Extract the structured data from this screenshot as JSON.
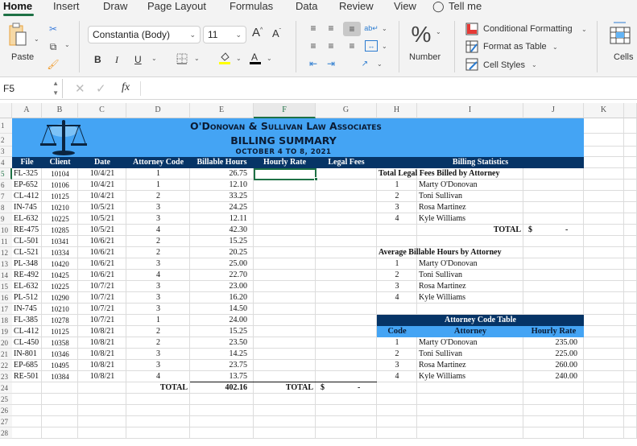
{
  "menu_tabs": [
    "Home",
    "Insert",
    "Draw",
    "Page Layout",
    "Formulas",
    "Data",
    "Review",
    "View",
    "Tell me"
  ],
  "ribbon": {
    "paste": "Paste",
    "font_name": "Constantia (Body)",
    "font_size": "11",
    "bold": "B",
    "italic": "I",
    "underline": "U",
    "number_label": "Number",
    "conditional_formatting": "Conditional Formatting",
    "format_as_table": "Format as Table",
    "cell_styles": "Cell Styles",
    "cells": "Cells",
    "highlight_color": "#ffff00",
    "font_color": "#000000"
  },
  "formula_bar": {
    "name_box": "F5",
    "fx": "fx",
    "value": ""
  },
  "columns": [
    "A",
    "B",
    "C",
    "D",
    "E",
    "F",
    "G",
    "H",
    "I",
    "J",
    "K"
  ],
  "selected_column": "F",
  "selected_row": "5",
  "rows": [
    "1",
    "2",
    "3",
    "4",
    "5",
    "6",
    "7",
    "8",
    "9",
    "10",
    "11",
    "12",
    "13",
    "14",
    "15",
    "16",
    "17",
    "18",
    "19",
    "20",
    "21",
    "22",
    "23",
    "24",
    "25",
    "26",
    "27",
    "28"
  ],
  "colors": {
    "band_light": "#44a4f4",
    "band_dark": "#063466",
    "selection": "#1e7145"
  },
  "sheet": {
    "title1": "O'Donovan & Sullivan Law Associates",
    "title2": "BILLING SUMMARY",
    "title3": "OCTOBER 4 TO 8, 2021",
    "headers": [
      "File",
      "Client",
      "Date",
      "Attorney Code",
      "Billable Hours",
      "Hourly Rate",
      "Legal Fees"
    ],
    "records": [
      [
        "FL-325",
        "10104",
        "10/4/21",
        "1",
        "26.75"
      ],
      [
        "EP-652",
        "10106",
        "10/4/21",
        "1",
        "12.10"
      ],
      [
        "CL-412",
        "10125",
        "10/4/21",
        "2",
        "33.25"
      ],
      [
        "IN-745",
        "10210",
        "10/5/21",
        "3",
        "24.25"
      ],
      [
        "EL-632",
        "10225",
        "10/5/21",
        "3",
        "12.11"
      ],
      [
        "RE-475",
        "10285",
        "10/5/21",
        "4",
        "42.30"
      ],
      [
        "CL-501",
        "10341",
        "10/6/21",
        "2",
        "15.25"
      ],
      [
        "CL-521",
        "10334",
        "10/6/21",
        "2",
        "20.25"
      ],
      [
        "PL-348",
        "10420",
        "10/6/21",
        "3",
        "25.00"
      ],
      [
        "RE-492",
        "10425",
        "10/6/21",
        "4",
        "22.70"
      ],
      [
        "EL-632",
        "10225",
        "10/7/21",
        "3",
        "23.00"
      ],
      [
        "PL-512",
        "10290",
        "10/7/21",
        "3",
        "16.20"
      ],
      [
        "IN-745",
        "10210",
        "10/7/21",
        "3",
        "14.50"
      ],
      [
        "FL-385",
        "10278",
        "10/7/21",
        "1",
        "24.00"
      ],
      [
        "CL-412",
        "10125",
        "10/8/21",
        "2",
        "15.25"
      ],
      [
        "CL-450",
        "10358",
        "10/8/21",
        "2",
        "23.50"
      ],
      [
        "IN-801",
        "10346",
        "10/8/21",
        "3",
        "14.25"
      ],
      [
        "EP-685",
        "10495",
        "10/8/21",
        "3",
        "23.75"
      ],
      [
        "RE-501",
        "10384",
        "10/8/21",
        "4",
        "13.75"
      ]
    ],
    "total_label": "TOTAL",
    "total_hours": "402.16",
    "total_fees_currency": "$",
    "total_fees_value": "-",
    "stats": {
      "header": "Billing Statistics",
      "fees_title": "Total Legal Fees Billed by Attorney",
      "avg_title": "Average Billable Hours by Attorney",
      "attorneys": [
        {
          "code": "1",
          "name": "Marty O'Donovan"
        },
        {
          "code": "2",
          "name": "Toni Sullivan"
        },
        {
          "code": "3",
          "name": "Rosa Martinez"
        },
        {
          "code": "4",
          "name": "Kyle Williams"
        }
      ],
      "total_label": "TOTAL",
      "total_currency": "$",
      "total_value": "-"
    },
    "code_table": {
      "title": "Attorney Code Table",
      "headers": [
        "Code",
        "Attorney",
        "Hourly Rate"
      ],
      "rows": [
        {
          "code": "1",
          "name": "Marty O'Donovan",
          "rate": "235.00"
        },
        {
          "code": "2",
          "name": "Toni Sullivan",
          "rate": "225.00"
        },
        {
          "code": "3",
          "name": "Rosa Martinez",
          "rate": "260.00"
        },
        {
          "code": "4",
          "name": "Kyle Williams",
          "rate": "240.00"
        }
      ]
    }
  }
}
